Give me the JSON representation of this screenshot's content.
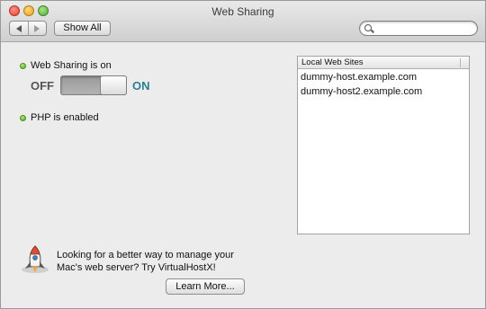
{
  "window": {
    "title": "Web Sharing"
  },
  "toolbar": {
    "back_icon": "chevron-left",
    "forward_icon": "chevron-right",
    "show_all_label": "Show All",
    "search": {
      "value": "",
      "placeholder": ""
    }
  },
  "web_sharing": {
    "status_label": "Web Sharing is on",
    "status_color": "#5aa92a",
    "off_label": "OFF",
    "on_label": "ON",
    "switch_state": "on",
    "on_color": "#2f7d94"
  },
  "php": {
    "status_label": "PHP is enabled"
  },
  "local_sites": {
    "header": "Local Web Sites",
    "items": [
      "dummy-host.example.com",
      "dummy-host2.example.com"
    ]
  },
  "promo": {
    "line1": "Looking for a better way to manage your",
    "line2": "Mac's web server? Try VirtualHostX!",
    "learn_more_label": "Learn More...",
    "icon": "rocket-icon"
  }
}
